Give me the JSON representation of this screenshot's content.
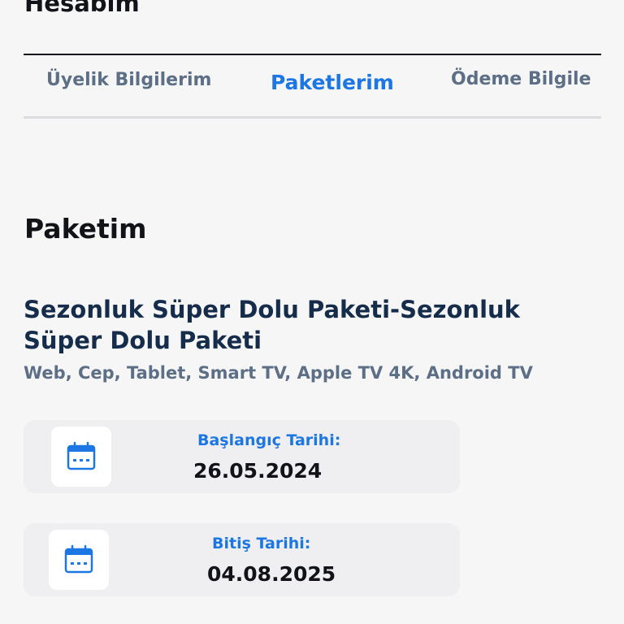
{
  "header": {
    "title": "Hesabım"
  },
  "tabs": [
    {
      "label": "Üyelik Bilgilerim",
      "active": false
    },
    {
      "label": "Paketlerim",
      "active": true
    },
    {
      "label": "Ödeme Bilgile",
      "active": false
    }
  ],
  "section": {
    "title": "Paketim"
  },
  "package": {
    "name": "Sezonluk Süper Dolu Paketi-Sezonluk Süper Dolu Paketi",
    "platforms": "Web, Cep, Tablet, Smart TV, Apple TV 4K, Android TV"
  },
  "dates": {
    "start_label": "Başlangıç Tarihi:",
    "start_value": "26.05.2024",
    "end_label": "Bitiş Tarihi:",
    "end_value": "04.08.2025",
    "icon": "calendar-icon"
  },
  "colors": {
    "accent": "#1c76e3",
    "muted": "#5d6f86",
    "package_title": "#152d4b"
  }
}
